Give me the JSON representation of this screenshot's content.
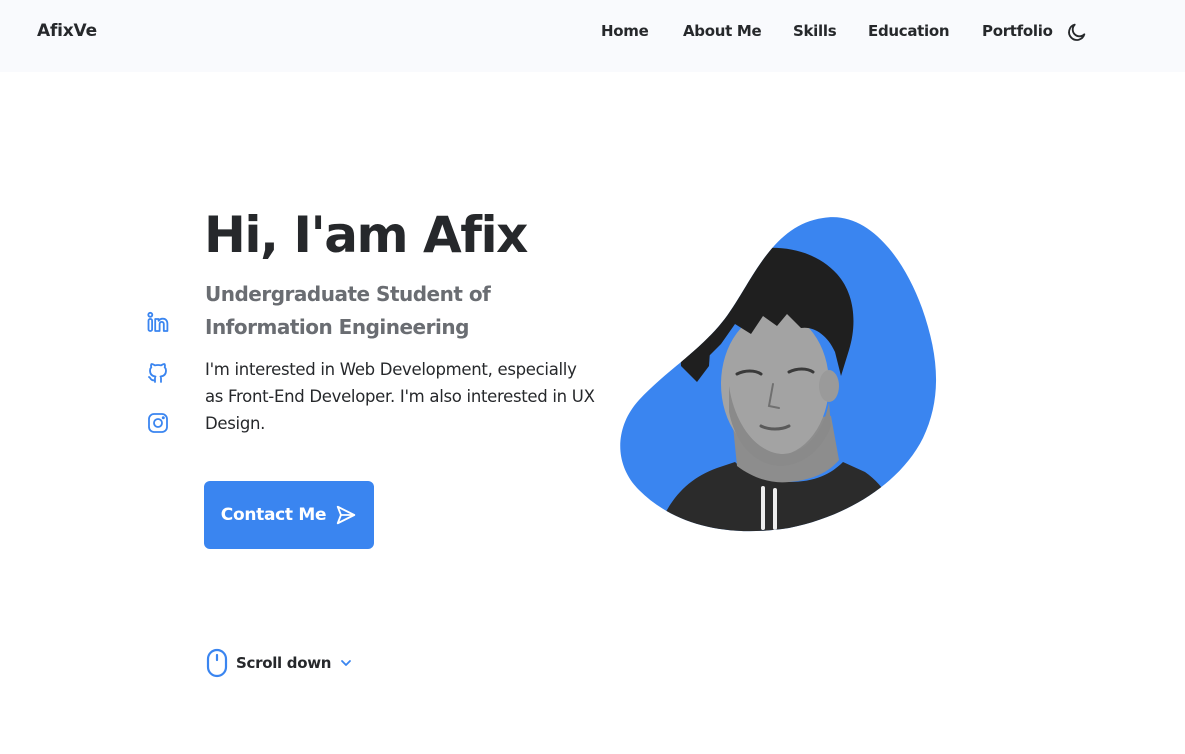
{
  "brand": {
    "logo": "AfixVe"
  },
  "nav": {
    "items": [
      {
        "label": "Home"
      },
      {
        "label": "About Me"
      },
      {
        "label": "Skills"
      },
      {
        "label": "Education"
      },
      {
        "label": "Portfolio"
      }
    ],
    "theme_icon": "moon-icon"
  },
  "social": [
    {
      "icon": "linkedin-icon"
    },
    {
      "icon": "github-icon"
    },
    {
      "icon": "instagram-icon"
    }
  ],
  "hero": {
    "title": "Hi, I'am Afix",
    "subtitle": "Undergraduate Student of Information Engineering",
    "description": "I'm interested in Web Development, especially as Front-End Developer. I'm also interested in UX Design.",
    "contact_label": "Contact Me",
    "contact_icon": "send-icon",
    "scroll_label": "Scroll down",
    "scroll_icon": "mouse-icon"
  },
  "colors": {
    "accent": "#3a85f0",
    "text": "#26282b",
    "muted": "#6a6d72",
    "header_bg": "#f9fafd"
  }
}
